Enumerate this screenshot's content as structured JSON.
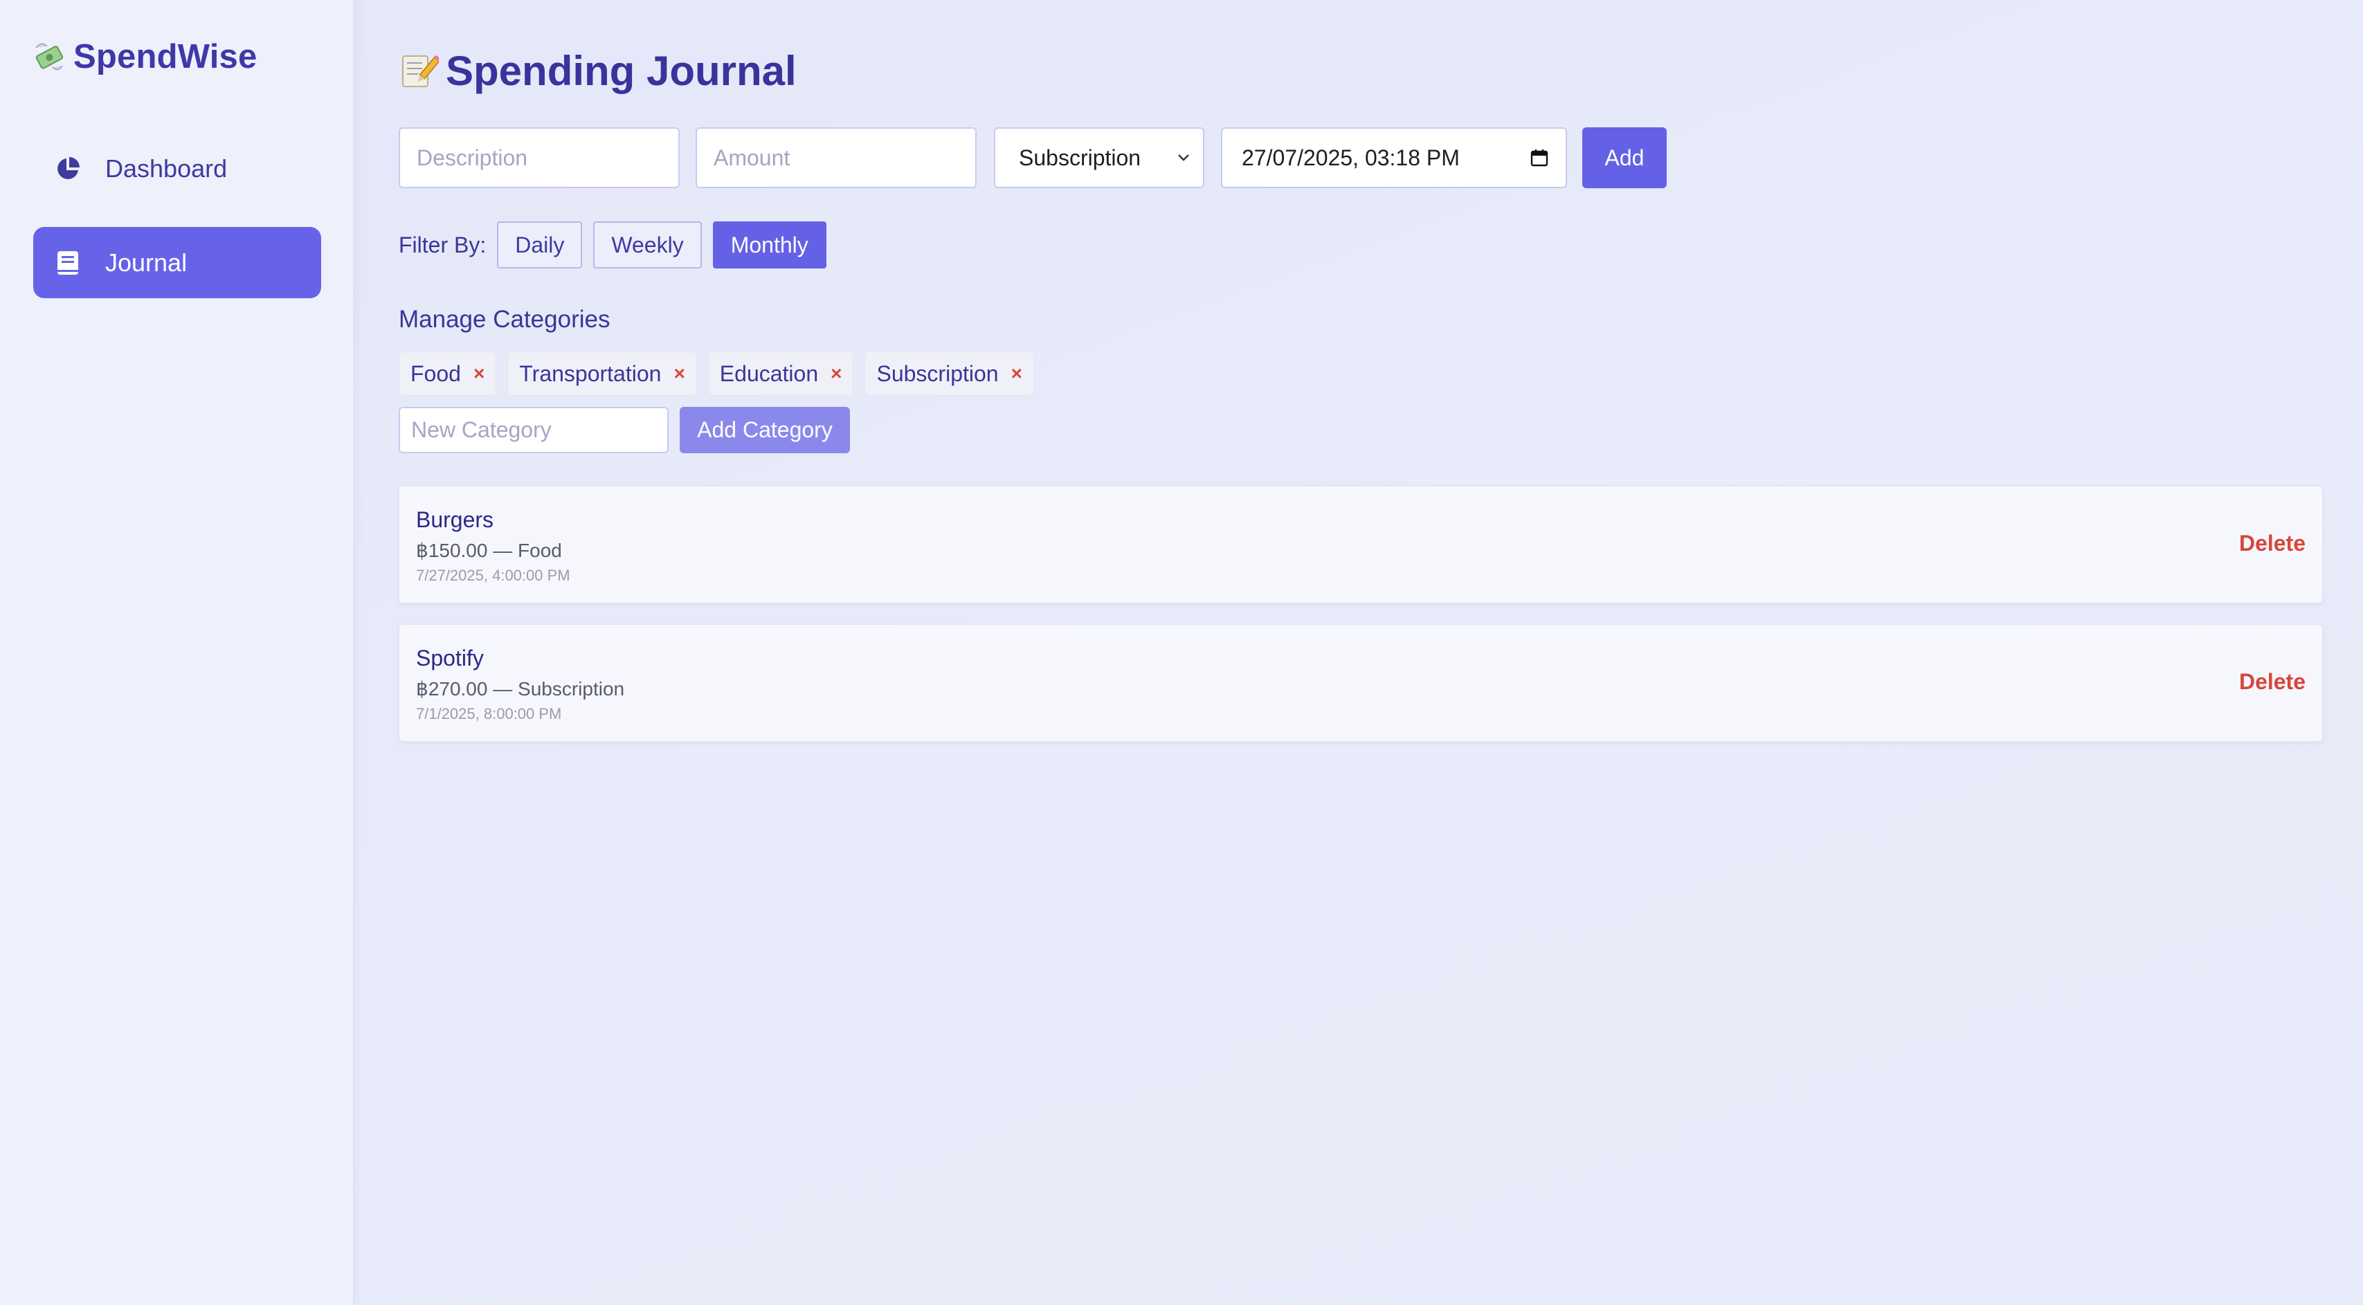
{
  "sidebar": {
    "brand": {
      "name": "SpendWise",
      "icon": "money-with-wings-icon"
    },
    "items": [
      {
        "label": "Dashboard",
        "icon": "pie-chart-icon",
        "active": false
      },
      {
        "label": "Journal",
        "icon": "book-icon",
        "active": true
      }
    ]
  },
  "main": {
    "title": "Spending Journal",
    "title_icon": "memo-icon",
    "form": {
      "description_placeholder": "Description",
      "amount_placeholder": "Amount",
      "category_selected": "Subscription",
      "datetime_value": "27/07/2025, 03:18 PM",
      "add_label": "Add"
    },
    "filter": {
      "label": "Filter By:",
      "options": [
        "Daily",
        "Weekly",
        "Monthly"
      ],
      "active": "Monthly"
    },
    "categories": {
      "title": "Manage Categories",
      "items": [
        "Food",
        "Transportation",
        "Education",
        "Subscription"
      ],
      "remove_glyph": "×",
      "new_placeholder": "New Category",
      "add_label": "Add Category"
    },
    "entries": [
      {
        "title": "Burgers",
        "meta": "฿150.00 — Food",
        "date": "7/27/2025, 4:00:00 PM",
        "delete_label": "Delete"
      },
      {
        "title": "Spotify",
        "meta": "฿270.00 — Subscription",
        "date": "7/1/2025, 8:00:00 PM",
        "delete_label": "Delete"
      }
    ]
  },
  "colors": {
    "accent": "#6461e6",
    "accent_light": "#8b88ec",
    "brand_text": "#3f38a8",
    "danger": "#d9453c"
  }
}
